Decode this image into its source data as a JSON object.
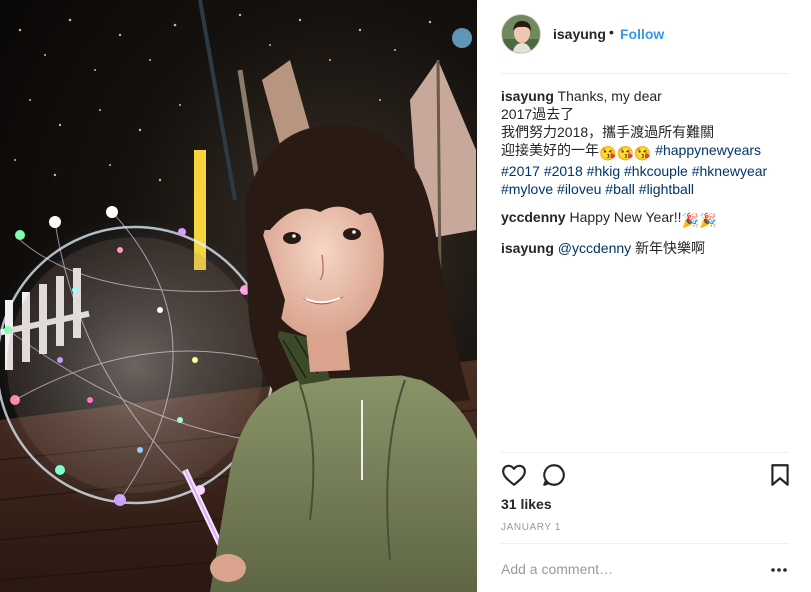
{
  "header": {
    "username": "isayung",
    "separator": "•",
    "follow_label": "Follow"
  },
  "caption": {
    "username": "isayung",
    "line1": "Thanks, my dear",
    "line2": "2017過去了",
    "line3": "我們努力2018，攜手渡過所有難關",
    "line4": "迎接美好的一年",
    "kiss_emoji": "😘",
    "tags": [
      "#happynewyears",
      "#2017",
      "#2018",
      "#hkig",
      "#hkcouple",
      "#hknewyear",
      "#mylove",
      "#iloveu",
      "#ball",
      "#lightball"
    ]
  },
  "comments": [
    {
      "username": "yccdenny",
      "text": "Happy New Year!!",
      "emoji": "🎉"
    },
    {
      "username": "isayung",
      "mention": "@yccdenny",
      "text": "新年快樂啊"
    }
  ],
  "actions": {
    "like_icon": "heart-outline-icon",
    "comment_icon": "speech-bubble-icon",
    "save_icon": "bookmark-icon"
  },
  "likes_text": "31 likes",
  "date_text": "JANUARY 1",
  "add_comment_placeholder": "Add a comment…",
  "more_icon": "more-options-icon",
  "colors": {
    "link_blue": "#3897f0",
    "hashtag_navy": "#003569",
    "muted_gray": "#999999",
    "divider": "#efefef"
  }
}
